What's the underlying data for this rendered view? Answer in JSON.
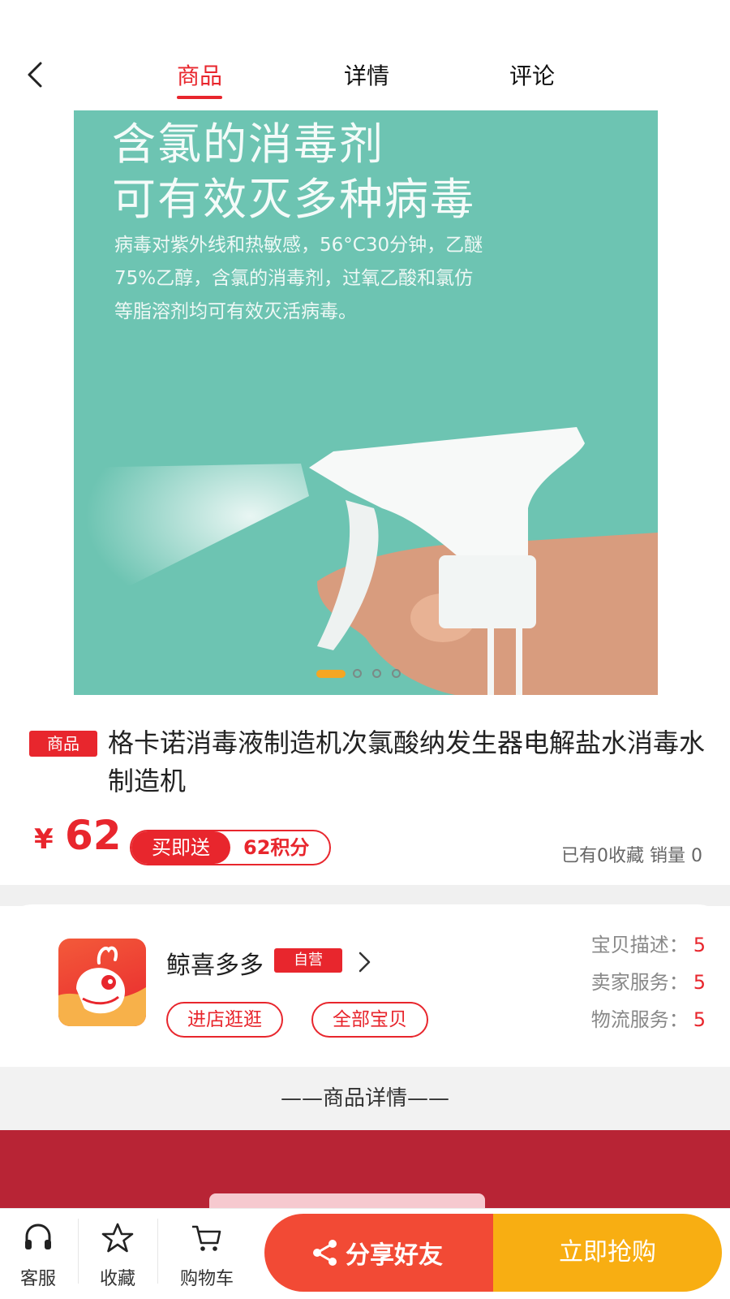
{
  "header": {
    "tabs": [
      {
        "label": "商品",
        "active": true
      },
      {
        "label": "详情",
        "active": false
      },
      {
        "label": "评论",
        "active": false
      }
    ]
  },
  "hero": {
    "headline_1": "含氯的消毒剂",
    "headline_2": "可有效灭多种病毒",
    "body_1": "病毒对紫外线和热敏感，56°C30分钟，乙醚",
    "body_2": "75%乙醇，含氯的消毒剂，过氧乙酸和氯仿",
    "body_3": "等脂溶剂均可有效灭活病毒。",
    "carousel": {
      "current": 1,
      "total": 4
    }
  },
  "product": {
    "tag": "商品",
    "title": "格卡诺消毒液制造机次氯酸纳发生器电解盐水消毒水制造机",
    "currency": "¥",
    "price": "62",
    "promo_label": "买即送",
    "promo_value": "62积分",
    "stats": "已有0收藏 销量 0"
  },
  "shop": {
    "name": "鲸喜多多",
    "badge": "自营",
    "enter_label": "进店逛逛",
    "all_label": "全部宝贝",
    "scores": [
      {
        "label": "宝贝描述：",
        "value": "5"
      },
      {
        "label": "卖家服务：",
        "value": "5"
      },
      {
        "label": "物流服务：",
        "value": "5"
      }
    ]
  },
  "detail_separator": "——商品详情——",
  "bottom_bar": {
    "service_label": "客服",
    "favorite_label": "收藏",
    "cart_label": "购物车",
    "share_label": "分享好友",
    "buy_label": "立即抢购"
  },
  "colors": {
    "accent": "#e8262d",
    "hero_bg": "#6dc4b2",
    "share_bg": "#f24a35",
    "buy_bg": "#f8ae12",
    "detail_banner_bg": "#b82435"
  }
}
